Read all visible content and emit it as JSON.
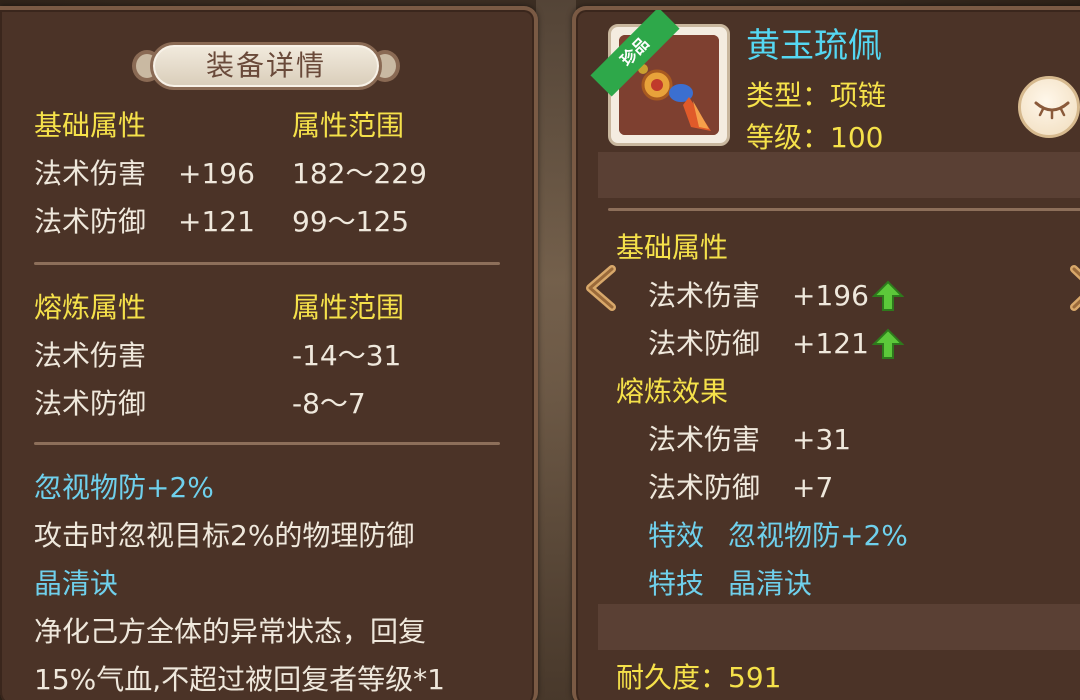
{
  "left": {
    "title": "装备详情",
    "base_header": "基础属性",
    "range_header": "属性范围",
    "base_rows": [
      {
        "name": "法术伤害",
        "value": "+196",
        "range": "182～229"
      },
      {
        "name": "法术防御",
        "value": "+121",
        "range": "99～125"
      }
    ],
    "smelt_header": "熔炼属性",
    "smelt_range_header": "属性范围",
    "smelt_rows": [
      {
        "name": "法术伤害",
        "range": "-14～31"
      },
      {
        "name": "法术防御",
        "range": "-8～7"
      }
    ],
    "effect_name": "忽视物防+2%",
    "effect_desc": "攻击时忽视目标2%的物理防御",
    "skill_name": "晶清诀",
    "skill_desc_line1": "净化己方全体的异常状态，回复",
    "skill_desc_line2": "15%气血,不超过被回复者等级*1"
  },
  "right": {
    "rarity_tag": "珍品",
    "item_name": "黄玉琉佩",
    "type_line": "类型：项链",
    "level_line": "等级：100",
    "base_header": "基础属性",
    "base_rows": [
      {
        "name": "法术伤害",
        "value": "+196",
        "icon": "green-up-arrow-icon"
      },
      {
        "name": "法术防御",
        "value": "+121",
        "icon": "green-up-arrow-icon"
      }
    ],
    "smelt_header": "熔炼效果",
    "smelt_rows": [
      {
        "name": "法术伤害",
        "value": "+31"
      },
      {
        "name": "法术防御",
        "value": "+7"
      }
    ],
    "special_effect_label": "特效",
    "special_effect_value": "忽视物防+2%",
    "special_skill_label": "特技",
    "special_skill_value": "晶清诀",
    "durability_line": "耐久度：591"
  },
  "colors": {
    "panel_bg": "#4b3327",
    "label_yellow": "#f5e14a",
    "text_white": "#efe8dc",
    "text_cyan": "#6fd0ec",
    "rarity_green": "#2ea84a"
  }
}
